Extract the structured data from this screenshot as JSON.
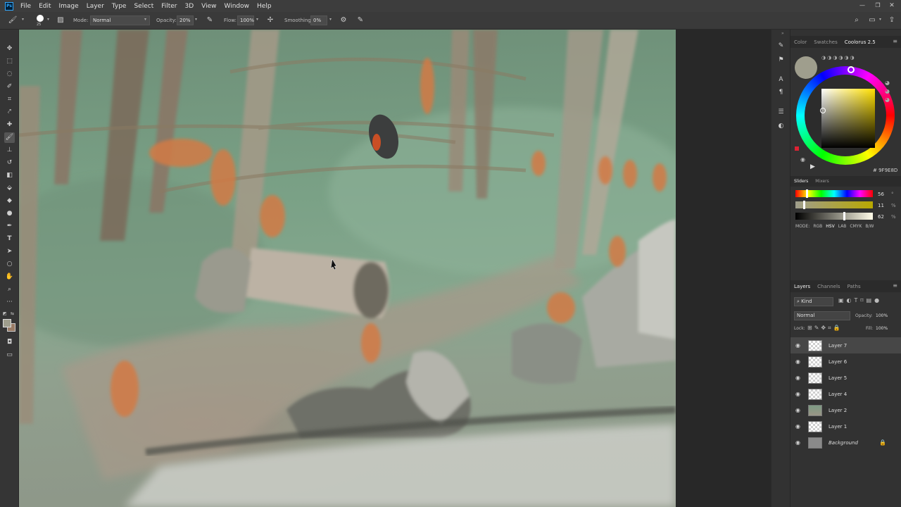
{
  "menu": [
    "File",
    "Edit",
    "Image",
    "Layer",
    "Type",
    "Select",
    "Filter",
    "3D",
    "View",
    "Window",
    "Help"
  ],
  "app_logo": "Ps",
  "options": {
    "brush_size": "25",
    "mode_label": "Mode:",
    "mode_value": "Normal",
    "opacity_label": "Opacity:",
    "opacity_value": "20%",
    "flow_label": "Flow:",
    "flow_value": "100%",
    "smoothing_label": "Smoothing:",
    "smoothing_value": "0%"
  },
  "color_panel": {
    "tabs": [
      "Color",
      "Swatches",
      "Coolorus 2.5"
    ],
    "hex": "# 9F9E8D",
    "foreground_color": "#9f9e8d"
  },
  "sliders_panel": {
    "tabs": [
      "Sliders",
      "Mixers"
    ],
    "values": [
      "56",
      "11",
      "62"
    ],
    "units": [
      "°",
      "%",
      "%"
    ],
    "mode_label": "MODE:",
    "modes": [
      "RGB",
      "HSV",
      "LAB",
      "CMYK",
      "B/W"
    ]
  },
  "layers_panel": {
    "tabs": [
      "Layers",
      "Channels",
      "Paths"
    ],
    "filter_kind": "Kind",
    "blend_mode": "Normal",
    "opacity_label": "Opacity:",
    "opacity_value": "100%",
    "lock_label": "Lock:",
    "fill_label": "Fill:",
    "fill_value": "100%",
    "layers": [
      "Layer 7",
      "Layer 6",
      "Layer 5",
      "Layer 4",
      "Layer 2",
      "Layer 1",
      "Background"
    ]
  }
}
